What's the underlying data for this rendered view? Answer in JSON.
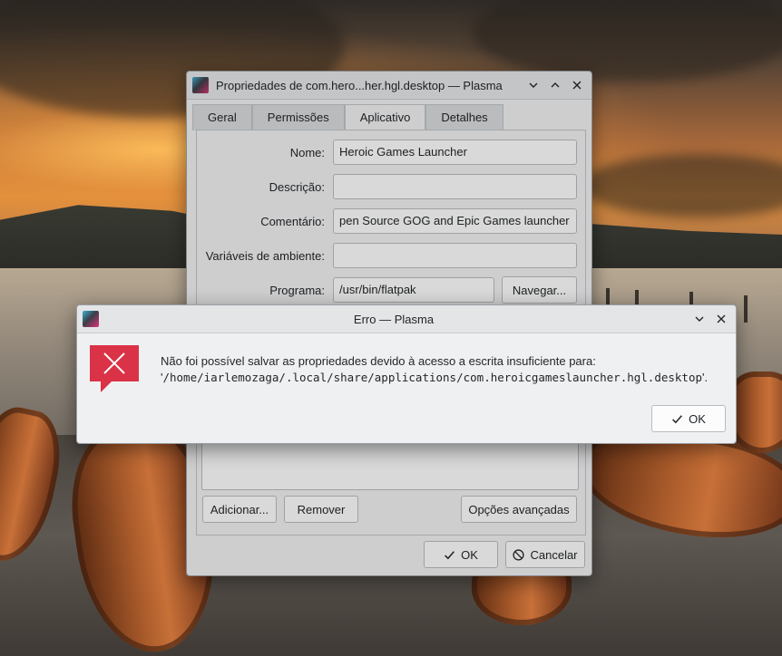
{
  "properties_window": {
    "title": "Propriedades de com.hero...her.hgl.desktop — Plasma",
    "tabs": [
      {
        "label": "Geral",
        "active": false
      },
      {
        "label": "Permissões",
        "active": false
      },
      {
        "label": "Aplicativo",
        "active": true
      },
      {
        "label": "Detalhes",
        "active": false
      }
    ],
    "form": {
      "name_label": "Nome:",
      "name_value": "Heroic Games Launcher",
      "description_label": "Descrição:",
      "description_value": "",
      "comment_label": "Comentário:",
      "comment_value": "pen Source GOG and Epic Games launcher",
      "env_label": "Variáveis de ambiente:",
      "env_value": "",
      "program_label": "Programa:",
      "program_value": "/usr/bin/flatpak",
      "browse_label": "Navegar..."
    },
    "add_label": "Adicionar...",
    "remove_label": "Remover",
    "advanced_label": "Opções avançadas",
    "ok_label": "OK",
    "cancel_label": "Cancelar"
  },
  "error_dialog": {
    "title": "Erro — Plasma",
    "message_line1": "Não foi possível salvar as propriedades devido à acesso a escrita insuficiente para:",
    "message_path_open": "'",
    "message_path": "/home/iarlemozaga/.local/share/applications/com.heroicgameslauncher.hgl.desktop",
    "message_path_close": "'.",
    "ok_label": "OK",
    "icon_color": "#da3247"
  }
}
